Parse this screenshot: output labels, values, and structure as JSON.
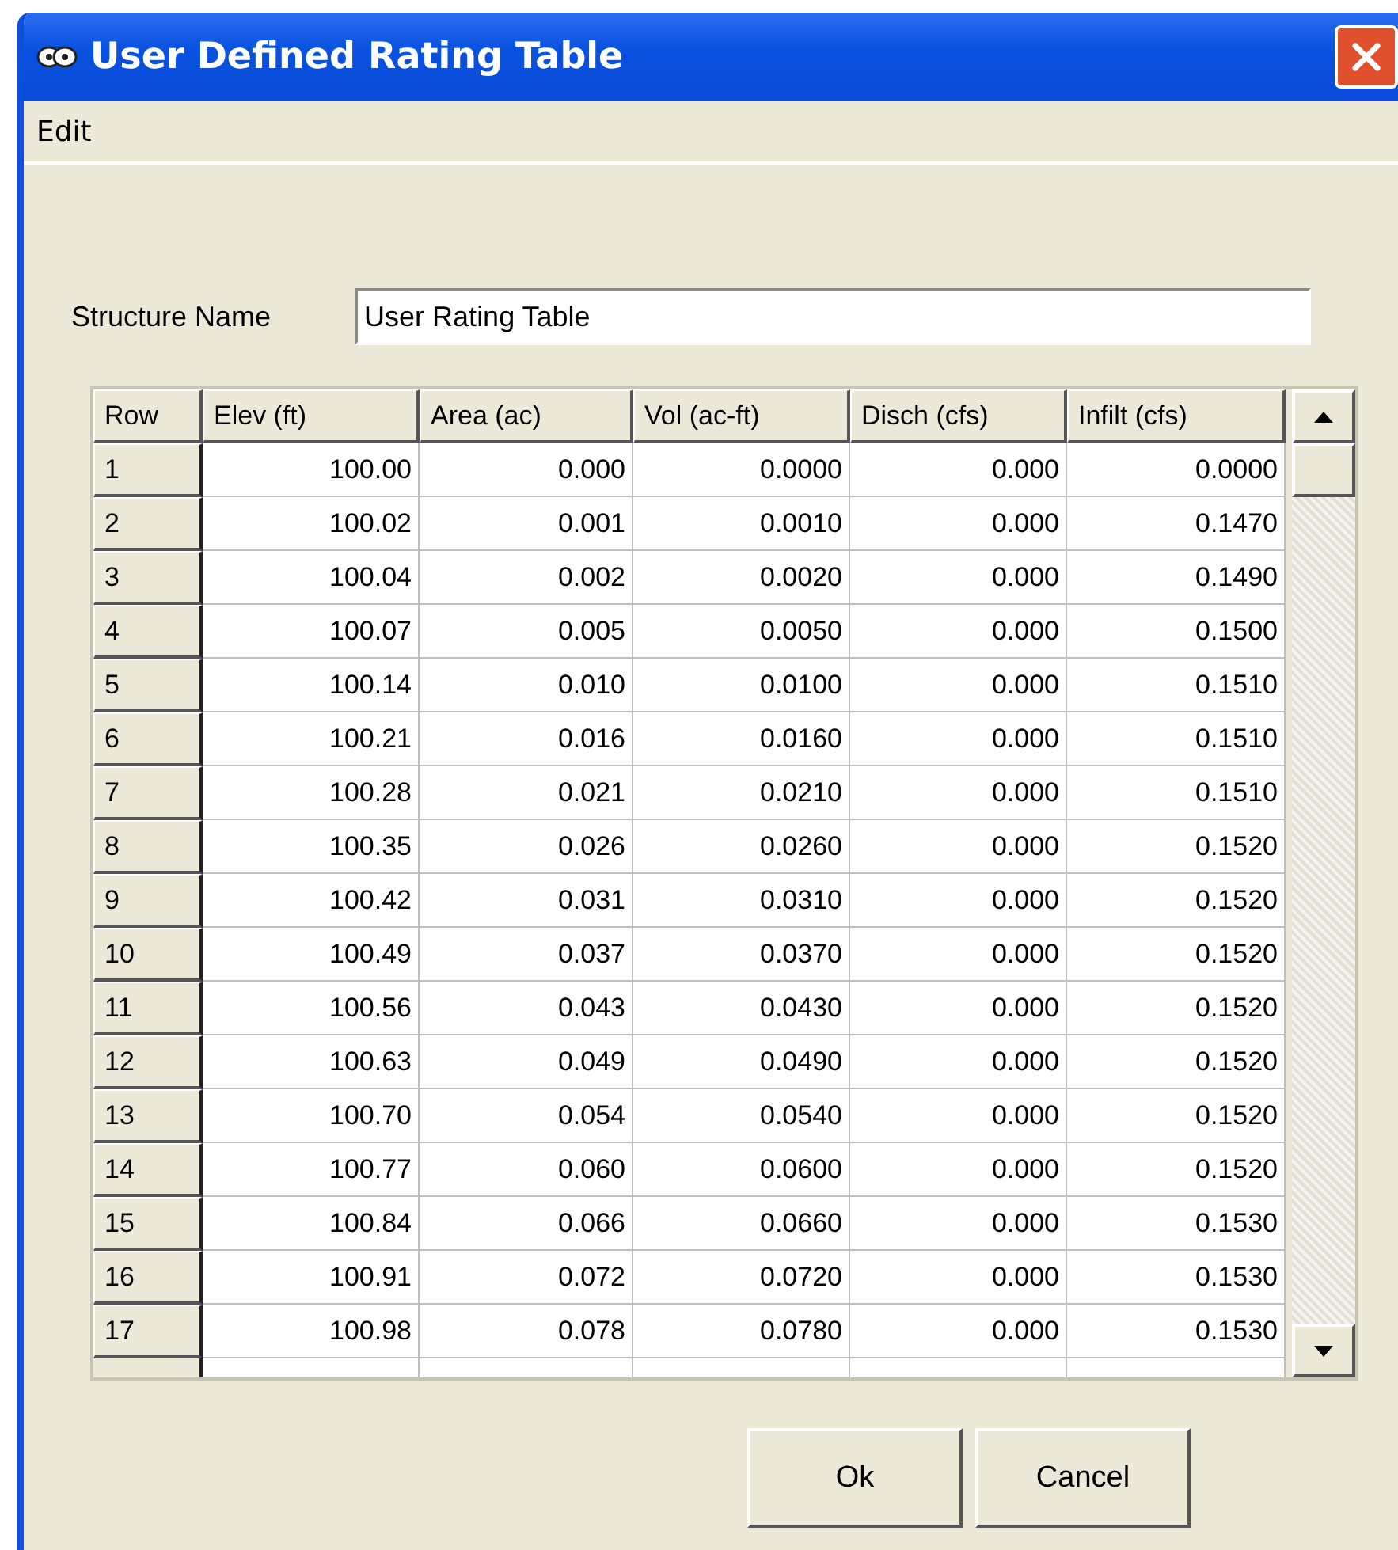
{
  "window": {
    "title": "User Defined Rating Table"
  },
  "menu": [
    "Edit"
  ],
  "structure_name": {
    "label": "Structure Name",
    "value": "User Rating Table"
  },
  "table": {
    "columns": [
      "Row",
      "Elev (ft)",
      "Area (ac)",
      "Vol (ac-ft)",
      "Disch (cfs)",
      "Infilt (cfs)"
    ],
    "rows": [
      [
        "1",
        "100.00",
        "0.000",
        "0.0000",
        "0.000",
        "0.0000"
      ],
      [
        "2",
        "100.02",
        "0.001",
        "0.0010",
        "0.000",
        "0.1470"
      ],
      [
        "3",
        "100.04",
        "0.002",
        "0.0020",
        "0.000",
        "0.1490"
      ],
      [
        "4",
        "100.07",
        "0.005",
        "0.0050",
        "0.000",
        "0.1500"
      ],
      [
        "5",
        "100.14",
        "0.010",
        "0.0100",
        "0.000",
        "0.1510"
      ],
      [
        "6",
        "100.21",
        "0.016",
        "0.0160",
        "0.000",
        "0.1510"
      ],
      [
        "7",
        "100.28",
        "0.021",
        "0.0210",
        "0.000",
        "0.1510"
      ],
      [
        "8",
        "100.35",
        "0.026",
        "0.0260",
        "0.000",
        "0.1520"
      ],
      [
        "9",
        "100.42",
        "0.031",
        "0.0310",
        "0.000",
        "0.1520"
      ],
      [
        "10",
        "100.49",
        "0.037",
        "0.0370",
        "0.000",
        "0.1520"
      ],
      [
        "11",
        "100.56",
        "0.043",
        "0.0430",
        "0.000",
        "0.1520"
      ],
      [
        "12",
        "100.63",
        "0.049",
        "0.0490",
        "0.000",
        "0.1520"
      ],
      [
        "13",
        "100.70",
        "0.054",
        "0.0540",
        "0.000",
        "0.1520"
      ],
      [
        "14",
        "100.77",
        "0.060",
        "0.0600",
        "0.000",
        "0.1520"
      ],
      [
        "15",
        "100.84",
        "0.066",
        "0.0660",
        "0.000",
        "0.1530"
      ],
      [
        "16",
        "100.91",
        "0.072",
        "0.0720",
        "0.000",
        "0.1530"
      ],
      [
        "17",
        "100.98",
        "0.078",
        "0.0780",
        "0.000",
        "0.1530"
      ]
    ]
  },
  "buttons": [
    "Ok",
    "Cancel"
  ]
}
